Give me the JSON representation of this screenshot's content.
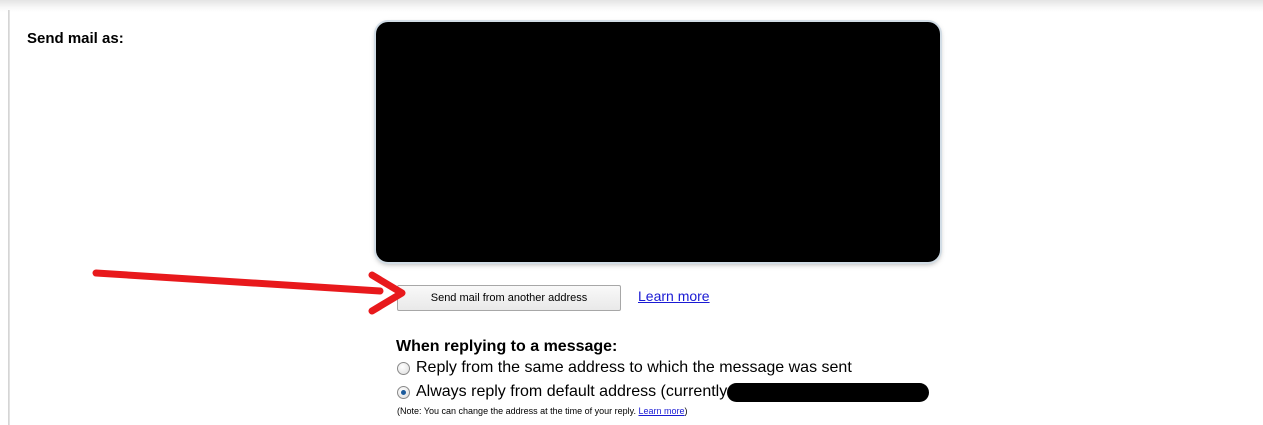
{
  "send_mail_as": {
    "label": "Send mail as:",
    "send_from_another_button": "Send mail from another address",
    "learn_more_link": "Learn more"
  },
  "reply_settings": {
    "heading": "When replying to a message:",
    "options": [
      {
        "label": "Reply from the same address to which the message was sent",
        "selected": false
      },
      {
        "label": "Always reply from default address (currently",
        "selected": true
      }
    ],
    "note_prefix": "(Note: You can change the address at the time of your reply. ",
    "note_link": "Learn more",
    "note_suffix": ")"
  },
  "colors": {
    "link": "#1a1ad4",
    "annotation_arrow": "#e8191c",
    "radio_selected": "#1c5b9c"
  }
}
